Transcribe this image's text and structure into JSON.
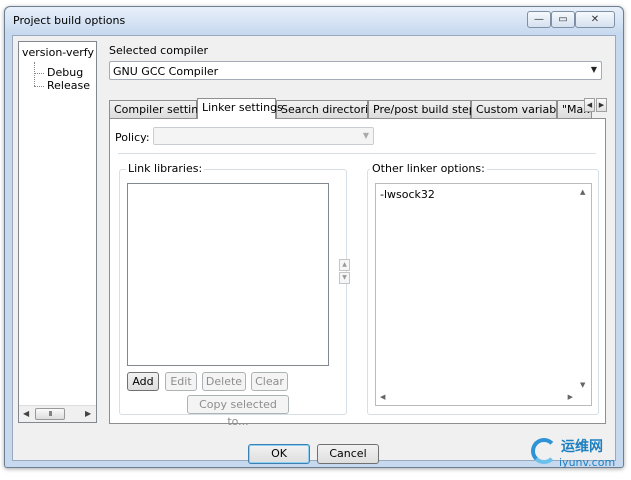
{
  "window": {
    "title": "Project build options",
    "minimize_icon": "minimize-icon",
    "maximize_icon": "maximize-icon",
    "close_icon": "close-icon",
    "minimize_glyph": "—",
    "maximize_glyph": "▭",
    "close_glyph": "✕"
  },
  "tree": {
    "root": "version-verfy",
    "children": [
      "Debug",
      "Release"
    ],
    "scroll_left": "◀",
    "scroll_right": "▶",
    "scroll_thumb": "III"
  },
  "compiler": {
    "label": "Selected compiler",
    "value": "GNU GCC Compiler",
    "arrow": "▼"
  },
  "tabs": [
    "Compiler settings",
    "Linker settings",
    "Search directories",
    "Pre/post build steps",
    "Custom variables",
    "\"Make"
  ],
  "tab_scroll": {
    "left": "◀",
    "right": "▶"
  },
  "active_tab_index": 1,
  "linker": {
    "policy_label": "Policy:",
    "policy_value": "",
    "policy_arrow": "▼",
    "link_libraries_label": "Link libraries:",
    "link_libraries": [],
    "other_options_label": "Other linker options:",
    "other_options_text": "-lwsock32",
    "spin_up": "▲",
    "spin_down": "▼",
    "scroll_up": "▲",
    "scroll_down": "▼",
    "scroll_left": "◀",
    "scroll_right": "▶",
    "buttons": {
      "add": "Add",
      "edit": "Edit",
      "delete": "Delete",
      "clear": "Clear",
      "copy": "Copy selected to..."
    }
  },
  "footer": {
    "ok": "OK",
    "cancel": "Cancel"
  },
  "watermark": {
    "cn": "运维网",
    "en": "iyunv.com"
  }
}
